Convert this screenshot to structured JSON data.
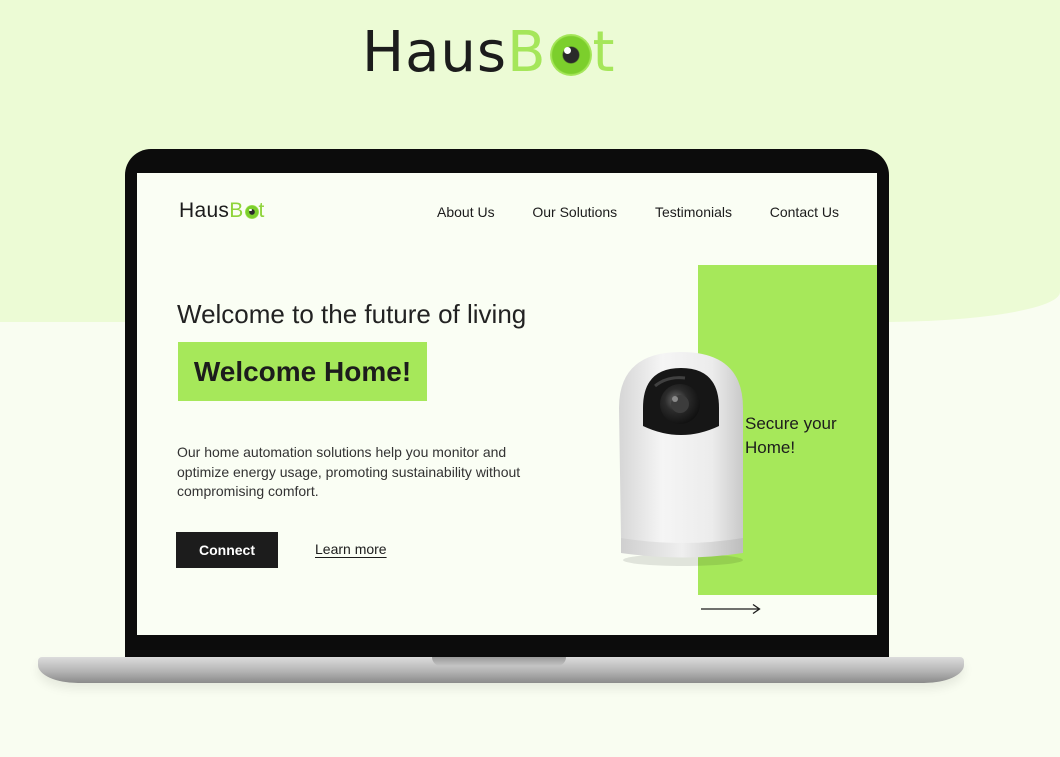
{
  "brand": {
    "logo_haus": "Haus",
    "logo_b": "B",
    "logo_t": "t",
    "accent_color": "#a6e85a",
    "dark_color": "#1c1c1c"
  },
  "nav": {
    "items": [
      "About Us",
      "Our Solutions",
      "Testimonials",
      "Contact Us"
    ]
  },
  "hero": {
    "subtitle": "Welcome to the future of living",
    "headline": "Welcome Home!",
    "description": "Our home automation solutions help you monitor and optimize energy usage, promoting sustainability without compromising comfort.",
    "connect_label": "Connect",
    "learn_more_label": "Learn more"
  },
  "panel": {
    "secure_text": "Secure your Home!",
    "camera_icon": "security-camera-image",
    "arrow_icon": "arrow-right-icon"
  }
}
